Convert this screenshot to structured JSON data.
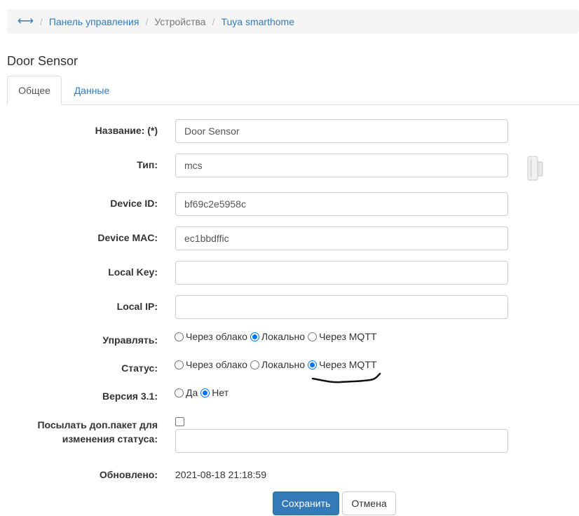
{
  "breadcrumb": {
    "items": [
      {
        "label": "Панель управления",
        "link": true
      },
      {
        "label": "Устройства",
        "link": false
      },
      {
        "label": "Tuya smarthome",
        "link": true
      }
    ]
  },
  "page": {
    "title": "Door Sensor"
  },
  "tabs": [
    {
      "label": "Общее",
      "active": true
    },
    {
      "label": "Данные",
      "active": false
    }
  ],
  "form": {
    "name": {
      "label": "Название: (*)",
      "value": "Door Sensor"
    },
    "type": {
      "label": "Тип:",
      "value": "mcs"
    },
    "device_id": {
      "label": "Device ID:",
      "value": "bf69c2e5958c"
    },
    "device_mac": {
      "label": "Device MAC:",
      "value": "ec1bbdffic"
    },
    "local_key": {
      "label": "Local Key:",
      "value": ""
    },
    "local_ip": {
      "label": "Local IP:",
      "value": ""
    },
    "control": {
      "label": "Управлять:",
      "options": [
        "Через облако",
        "Локально",
        "Через MQTT"
      ],
      "selected": "Локально"
    },
    "status": {
      "label": "Статус:",
      "options": [
        "Через облако",
        "Локально",
        "Через MQTT"
      ],
      "selected": "Через MQTT"
    },
    "version": {
      "label": "Версия 3.1:",
      "options": [
        "Да",
        "Нет"
      ],
      "selected": "Нет"
    },
    "extra_packet": {
      "label_line1": "Посылать доп.пакет для",
      "label_line2": "изменения статуса:",
      "checked": false,
      "value": ""
    },
    "updated": {
      "label": "Обновлено:",
      "value": "2021-08-18 21:18:59"
    }
  },
  "buttons": {
    "save": "Сохранить",
    "cancel": "Отмена"
  },
  "colors": {
    "accent": "#337ab7",
    "radio_checked": "#0075ff"
  },
  "icons": {
    "home": "horizontal-arrows-icon",
    "device": "door-sensor-icon"
  }
}
